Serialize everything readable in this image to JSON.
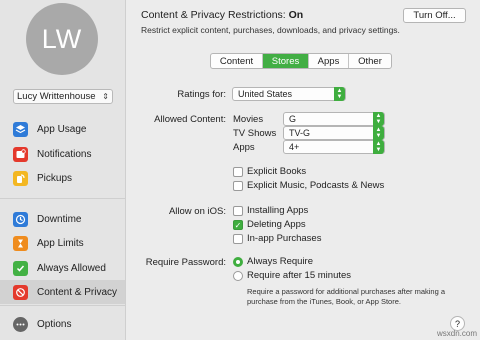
{
  "sidebar": {
    "avatar_initials": "LW",
    "user_name": "Lucy Writtenhouse",
    "items": [
      {
        "label": "App Usage",
        "icon": "layers-icon",
        "color": "#2f7bd8"
      },
      {
        "label": "Notifications",
        "icon": "notification-icon",
        "color": "#e4392c"
      },
      {
        "label": "Pickups",
        "icon": "pickup-icon",
        "color": "#f3b722"
      },
      {
        "label": "Downtime",
        "icon": "moon-clock-icon",
        "color": "#2f7bd8"
      },
      {
        "label": "App Limits",
        "icon": "hourglass-icon",
        "color": "#ef8c1e"
      },
      {
        "label": "Always Allowed",
        "icon": "checkmark-shield-icon",
        "color": "#43b144"
      },
      {
        "label": "Content & Privacy",
        "icon": "no-entry-icon",
        "color": "#e4392c"
      },
      {
        "label": "Options",
        "icon": "options-icon",
        "color": "#666666"
      }
    ],
    "selected": "Content & Privacy"
  },
  "header": {
    "title": "Content & Privacy Restrictions:",
    "status": "On",
    "subtitle": "Restrict explicit content, purchases, downloads, and privacy settings.",
    "turn_off_label": "Turn Off..."
  },
  "tabs": [
    "Content",
    "Stores",
    "Apps",
    "Other"
  ],
  "active_tab": "Stores",
  "ratings": {
    "label": "Ratings for:",
    "value": "United States"
  },
  "allowed_content": {
    "label": "Allowed Content:",
    "items": [
      {
        "label": "Movies",
        "value": "G"
      },
      {
        "label": "TV Shows",
        "value": "TV-G"
      },
      {
        "label": "Apps",
        "value": "4+"
      }
    ]
  },
  "explicit": [
    {
      "label": "Explicit Books",
      "checked": false
    },
    {
      "label": "Explicit Music, Podcasts & News",
      "checked": false
    }
  ],
  "allow_ios": {
    "label": "Allow on iOS:",
    "items": [
      {
        "label": "Installing Apps",
        "checked": false
      },
      {
        "label": "Deleting Apps",
        "checked": true
      },
      {
        "label": "In-app Purchases",
        "checked": false
      }
    ]
  },
  "password": {
    "label": "Require Password:",
    "options": [
      {
        "label": "Always Require",
        "selected": true
      },
      {
        "label": "Require after 15 minutes",
        "selected": false
      }
    ],
    "note": "Require a password for additional purchases after making a purchase from the iTunes, Book, or App Store."
  },
  "help_label": "?",
  "watermark": "wsxdn.com"
}
